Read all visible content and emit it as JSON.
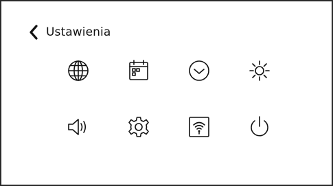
{
  "header": {
    "back_icon": "chevron-left-icon",
    "title": "Ustawienia"
  },
  "settings_grid": {
    "rows": [
      [
        {
          "icon": "globe-icon"
        },
        {
          "icon": "calendar-icon"
        },
        {
          "icon": "clock-icon"
        },
        {
          "icon": "brightness-icon"
        }
      ],
      [
        {
          "icon": "speaker-icon"
        },
        {
          "icon": "gear-icon"
        },
        {
          "icon": "wifi-icon"
        },
        {
          "icon": "power-icon"
        }
      ]
    ]
  },
  "colors": {
    "foreground": "#111111",
    "background": "#ffffff",
    "frame": "#2a2a2a"
  }
}
